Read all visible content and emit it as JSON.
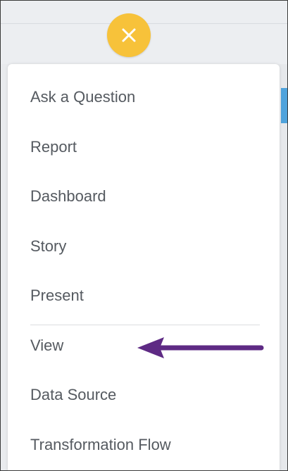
{
  "close_button": {
    "icon": "close-icon",
    "color": "#f7c23a"
  },
  "menu": {
    "items": [
      {
        "label": "Ask a Question"
      },
      {
        "label": "Report"
      },
      {
        "label": "Dashboard"
      },
      {
        "label": "Story"
      },
      {
        "label": "Present"
      },
      {
        "label": "View"
      },
      {
        "label": "Data Source"
      },
      {
        "label": "Transformation Flow"
      }
    ]
  },
  "annotation": {
    "icon": "arrow-left-icon",
    "color": "#5e2a84",
    "points_to": "View"
  }
}
